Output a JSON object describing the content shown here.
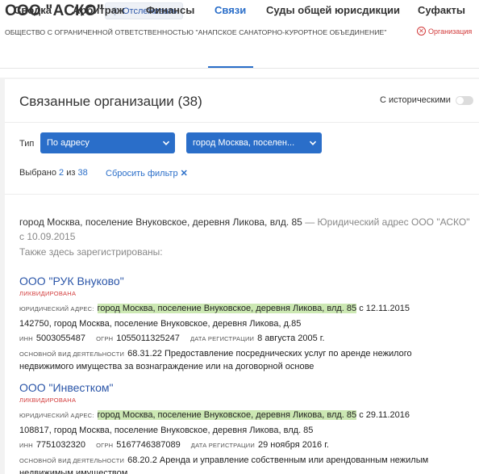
{
  "header": {
    "company_title": "ООО \"АСКО\"",
    "follow_label": "Отслеживать",
    "full_name": "ОБЩЕСТВО С ОГРАНИЧЕННОЙ ОТВЕТСТВЕННОСТЬЮ \"АНАПСКОЕ САНАТОРНО-КУРОРТНОЕ ОБЪЕДИНЕНИЕ\"",
    "status": "Организация"
  },
  "tabs": [
    {
      "label": "Сводка",
      "active": false
    },
    {
      "label": "Арбитраж",
      "active": false
    },
    {
      "label": "Финансы",
      "active": false
    },
    {
      "label": "Связи",
      "active": true
    },
    {
      "label": "Суды общей юрисдикции",
      "active": false
    },
    {
      "label": "Суфакты",
      "active": false
    }
  ],
  "panel": {
    "title": "Связанные организации (38)",
    "historical_label": "С историческими",
    "historical_on": false,
    "filter": {
      "type_label": "Тип",
      "type_value": "По адресу",
      "address_value": "город Москва, поселен...",
      "selected_prefix": "Выбрано",
      "selected_count": "2",
      "of_word": "из",
      "total_count": "38",
      "reset_label": "Сбросить фильтр"
    },
    "address": {
      "line": "город Москва, поселение Внуковское, деревня Ликова, влд. 85",
      "suffix": "— Юридический адрес ООО \"АСКО\" с 10.09.2015",
      "also_registered": "Также здесь зарегистрированы:"
    },
    "labels": {
      "legal_address": "ЮРИДИЧЕСКИЙ АДРЕС:",
      "inn": "ИНН",
      "ogrn": "ОГРН",
      "reg_date": "ДАТА РЕГИСТРАЦИИ",
      "activity": "ОСНОВНОЙ ВИД ДЕЯТЕЛЬНОСТИ"
    },
    "orgs": [
      {
        "name": "ООО \"РУК Внуково\"",
        "status": "ЛИКВИДИРОВАНА",
        "address_highlight": "город Москва, поселение Внуковское, деревня Ликова, влд. 85",
        "address_since": "с 12.11.2015",
        "address_full": "142750, город Москва, поселение Внуковское, деревня Ликова, д.85",
        "inn": "5003055487",
        "ogrn": "1055011325247",
        "reg_date": "8 августа 2005 г.",
        "activity_line1": "68.31.22 Предоставление посреднических услуг по аренде нежилого",
        "activity_line2": "недвижимого имущества за вознаграждение или на договорной основе"
      },
      {
        "name": "ООО \"Инвестком\"",
        "status": "ЛИКВИДИРОВАНА",
        "address_highlight": "город Москва, поселение Внуковское, деревня Ликова, влд. 85",
        "address_since": "с 29.11.2016",
        "address_full": "108817, город Москва, поселение Внуковское, деревня Ликова, влд. 85",
        "inn": "7751032320",
        "ogrn": "5167746387089",
        "reg_date": "29 ноября 2016 г.",
        "activity_line1": "68.20.2 Аренда и управление собственным или арендованным нежилым",
        "activity_line2": "недвижимым имуществом"
      }
    ]
  },
  "colors": {
    "accent": "#2a6ec9",
    "link": "#2a55a8",
    "danger": "#d23b3b",
    "highlight": "#cce8b3"
  }
}
